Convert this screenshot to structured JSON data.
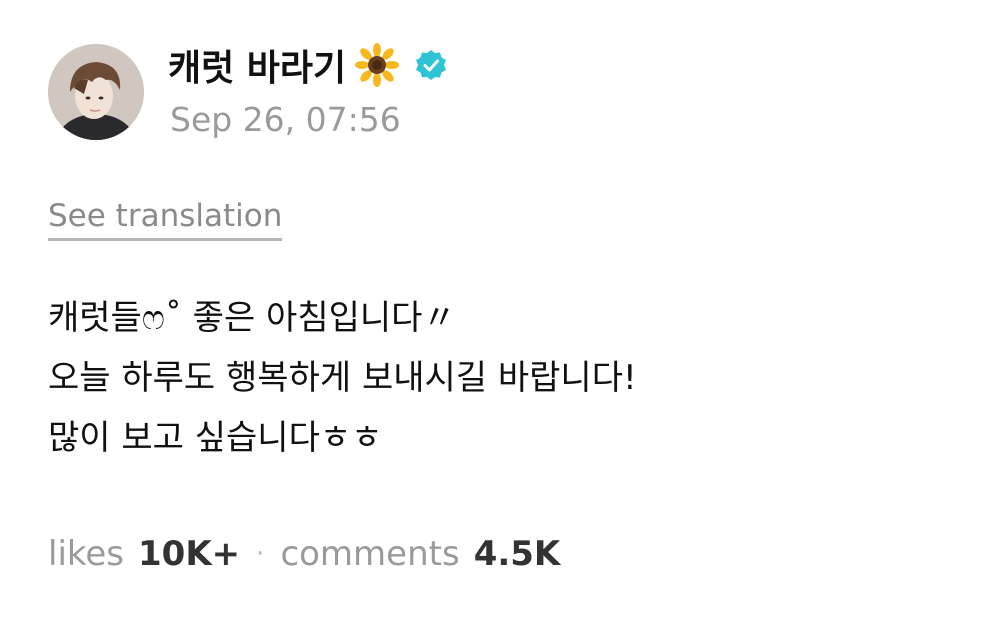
{
  "post": {
    "author": {
      "name": "캐럿 바라기",
      "avatar_icon": "avatar",
      "name_icon": "sunflower-icon",
      "verified_icon": "verified-badge-icon",
      "verified_color": "#2ec4d6"
    },
    "timestamp": "Sep 26, 07:56",
    "see_translation_label": "See translation",
    "body_lines": [
      "캐럿들ෆ˚ 좋은 아침입니다〃",
      "오늘 하루도 행복하게 보내시길 바랍니다!",
      "많이 보고 싶습니다ㅎㅎ"
    ],
    "stats": {
      "likes_label": "likes",
      "likes_value": "10K+",
      "separator": "·",
      "comments_label": "comments",
      "comments_value": "4.5K"
    }
  }
}
